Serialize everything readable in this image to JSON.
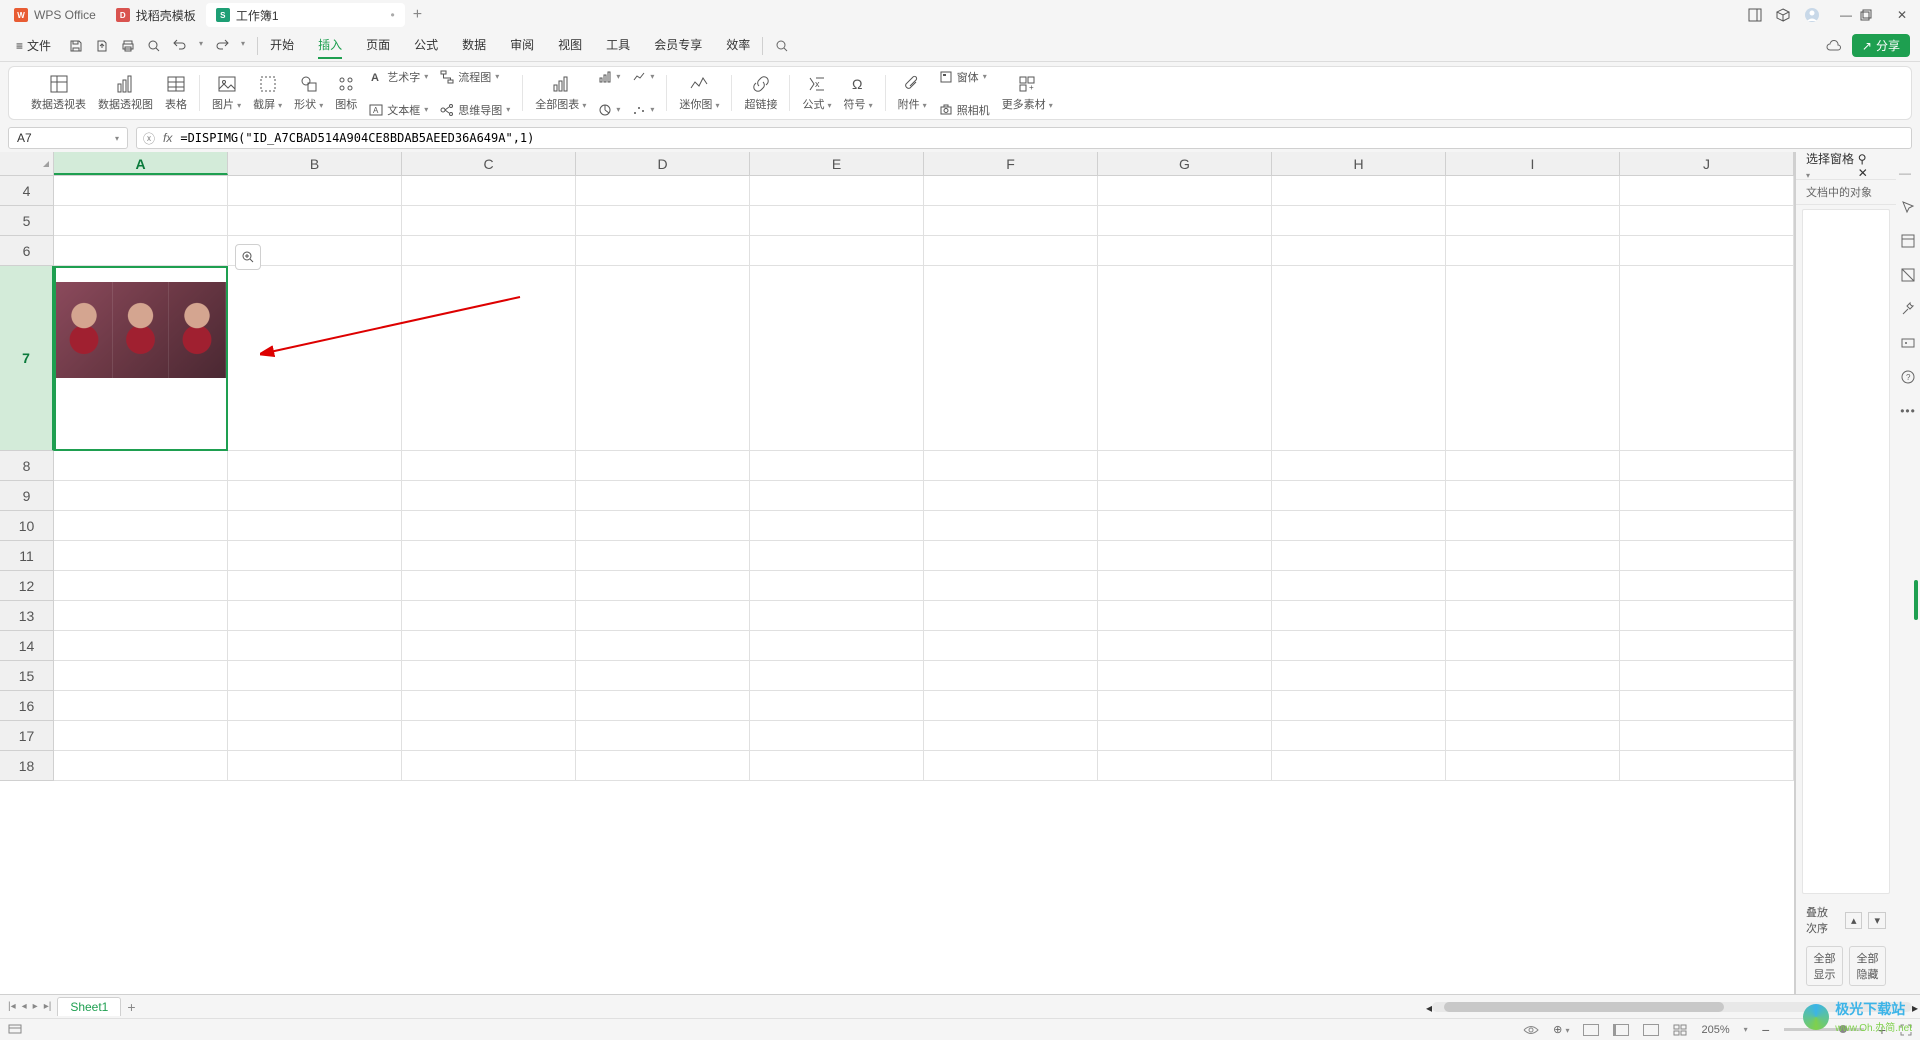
{
  "tabs": {
    "app": "WPS Office",
    "template": "找稻壳模板",
    "doc": "工作簿1"
  },
  "file_menu": "文件",
  "menu": [
    "开始",
    "插入",
    "页面",
    "公式",
    "数据",
    "审阅",
    "视图",
    "工具",
    "会员专享",
    "效率"
  ],
  "active_menu": "插入",
  "share": "分享",
  "ribbon": {
    "pivot_table": "数据透视表",
    "pivot_chart": "数据透视图",
    "table": "表格",
    "picture": "图片",
    "screenshot": "截屏",
    "shapes": "形状",
    "icons": "图标",
    "wordart": "艺术字",
    "textbox": "文本框",
    "flowchart": "流程图",
    "mindmap": "思维导图",
    "all_charts": "全部图表",
    "sparkline": "迷你图",
    "hyperlink": "超链接",
    "formula": "公式",
    "symbol": "符号",
    "attachment": "附件",
    "camera": "照相机",
    "form_ctrl": "窗体",
    "more": "更多素材"
  },
  "cell_ref": "A7",
  "formula": "=DISPIMG(\"ID_A7CBAD514A904CE8BDAB5AEED36A649A\",1)",
  "columns": [
    "A",
    "B",
    "C",
    "D",
    "E",
    "F",
    "G",
    "H",
    "I",
    "J"
  ],
  "rows": [
    "4",
    "5",
    "6",
    "7",
    "8",
    "9",
    "10",
    "11",
    "12",
    "13",
    "14",
    "15",
    "16",
    "17",
    "18"
  ],
  "selected_col": "A",
  "selected_row": "7",
  "panel": {
    "title": "选择窗格",
    "subtitle": "文档中的对象",
    "stack": "叠放次序",
    "show_all": "全部显示",
    "hide_all": "全部隐藏"
  },
  "sheet_tab": "Sheet1",
  "zoom": "205%",
  "watermark": {
    "brand": "极光下载站",
    "url": "www.Oh.办简.net"
  }
}
